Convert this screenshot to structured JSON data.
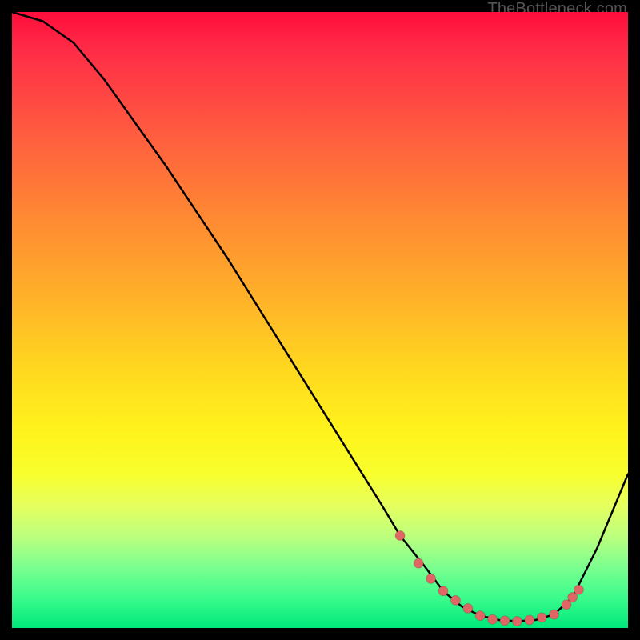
{
  "watermark": "TheBottleneck.com",
  "chart_data": {
    "type": "line",
    "title": "",
    "xlabel": "",
    "ylabel": "",
    "xlim": [
      0,
      100
    ],
    "ylim": [
      0,
      100
    ],
    "grid": false,
    "legend": false,
    "background": "rainbow-gradient-red-to-green",
    "series": [
      {
        "name": "bottleneck-curve",
        "color": "#000000",
        "x": [
          0,
          5,
          10,
          15,
          20,
          25,
          30,
          35,
          40,
          45,
          50,
          55,
          60,
          63,
          67,
          70,
          73,
          76,
          79,
          82,
          85,
          88,
          91,
          95,
          100
        ],
        "y": [
          100,
          98.5,
          95,
          89,
          82,
          75,
          67.5,
          60,
          52,
          44,
          36,
          28,
          20,
          15,
          10,
          6,
          3.5,
          2,
          1.3,
          1.1,
          1.3,
          2.2,
          5,
          13,
          25
        ]
      },
      {
        "name": "highlight-dots",
        "type": "scatter",
        "color": "#e06666",
        "x": [
          63,
          66,
          68,
          70,
          72,
          74,
          76,
          78,
          80,
          82,
          84,
          86,
          88,
          90,
          91,
          92
        ],
        "y": [
          15,
          10.5,
          8,
          6,
          4.5,
          3.2,
          2,
          1.4,
          1.2,
          1.1,
          1.3,
          1.7,
          2.2,
          3.8,
          5,
          6.2
        ]
      }
    ]
  }
}
